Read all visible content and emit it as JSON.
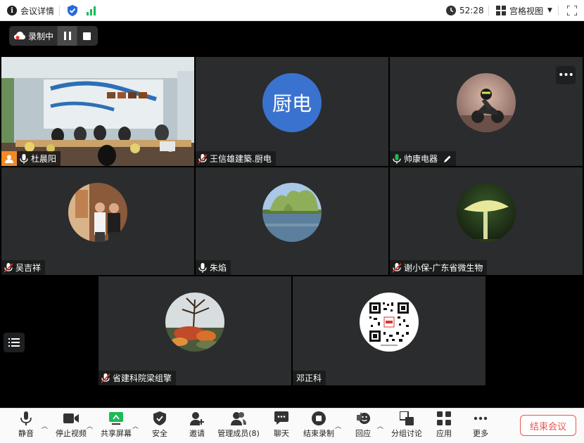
{
  "topbar": {
    "meeting_info": "会议详情",
    "timer": "52:28",
    "view_mode": "宫格视图"
  },
  "recording": {
    "label": "录制中"
  },
  "tiles": [
    {
      "name": "杜晨阳",
      "mic": "on"
    },
    {
      "name": "王信雄建築.厨电",
      "mic": "muted",
      "avatar_text": "厨电"
    },
    {
      "name": "帅康电器",
      "mic": "on-green",
      "edit_icon": "pencil-icon"
    },
    {
      "name": "吴吉祥",
      "mic": "muted"
    },
    {
      "name": "朱焰",
      "mic": "on"
    },
    {
      "name": "谢小保-广东省微生物",
      "mic": "muted"
    },
    {
      "name": "省建科院梁组擎",
      "mic": "muted"
    },
    {
      "name": "邓正科",
      "mic": "none"
    }
  ],
  "toolbar": {
    "mute": "静音",
    "stop_video": "停止视频",
    "share_screen": "共享屏幕",
    "security": "安全",
    "invite": "邀请",
    "participants": "管理成员(8)",
    "chat": "聊天",
    "end_recording": "结束录制",
    "reactions": "回应",
    "breakout": "分组讨论",
    "apps": "应用",
    "more": "更多",
    "end_meeting": "结束会议"
  },
  "colors": {
    "accent_blue": "#2a6ad8",
    "signal_green": "#1bbb57",
    "end_red": "#e5574f",
    "tile_bg": "#2b2c2e"
  }
}
